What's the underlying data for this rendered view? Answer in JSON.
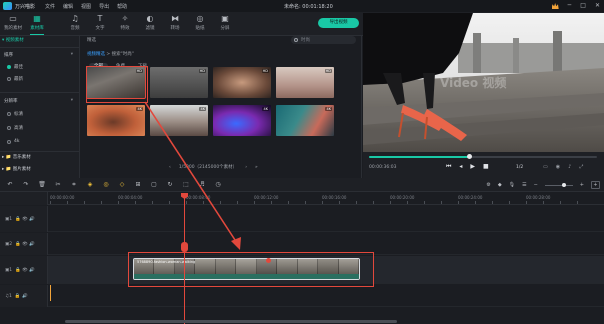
{
  "app": {
    "name": "万兴喵影",
    "menus": [
      "文件",
      "编辑",
      "视图",
      "导出",
      "帮助"
    ],
    "document_title": "未命名: 00:01:18:20",
    "window_controls": [
      "─",
      "□",
      "✕"
    ]
  },
  "toolbar": {
    "tools": [
      {
        "label": "我的素材",
        "icon": "folder-icon"
      },
      {
        "label": "素材库",
        "icon": "media-library-icon"
      },
      {
        "label": "音频",
        "icon": "music-note-icon"
      },
      {
        "label": "文字",
        "icon": "text-icon"
      },
      {
        "label": "特效",
        "icon": "effects-icon"
      },
      {
        "label": "滤镜",
        "icon": "filter-icon"
      },
      {
        "label": "转场",
        "icon": "transition-icon"
      },
      {
        "label": "贴纸",
        "icon": "sticker-icon"
      },
      {
        "label": "分屏",
        "icon": "split-screen-icon"
      }
    ],
    "active_tool": "素材库",
    "export_label": "导出视频"
  },
  "sidebar": {
    "header": "▾ 视频素材",
    "sections": [
      {
        "title": "排序",
        "items": [
          {
            "label": "最佳",
            "selected": true
          },
          {
            "label": "最新",
            "selected": false
          }
        ]
      },
      {
        "title": "分辨率",
        "items": [
          {
            "label": "标清",
            "selected": false
          },
          {
            "label": "高清",
            "selected": false
          },
          {
            "label": "4k",
            "selected": false
          }
        ]
      }
    ],
    "folders": [
      "▸ 📁 音乐素材",
      "▸ 📁 图片素材"
    ]
  },
  "library": {
    "heading": "精选",
    "search_placeholder": "时尚",
    "breadcrumb_link": "视频精选",
    "breadcrumb_rest": " > 搜索\"时尚\"",
    "subtabs": [
      "全部",
      "免费",
      "下载"
    ],
    "active_subtab": "全部",
    "thumb_badges": [
      "HD",
      "HD",
      "HD",
      "HD",
      "4K",
      "4K",
      "4K",
      "4K"
    ],
    "pager_text": "1/5000（2145000个素材）",
    "prev": "‹",
    "next": "›",
    "last": "»"
  },
  "preview": {
    "timecode": "00:00:36:03",
    "ratio": "1/2",
    "progress": 0.44,
    "watermark": "Video 视频"
  },
  "timeline": {
    "ruler_labels": [
      "00:00:00:00",
      "00:00:04:00",
      "00:00:08:00",
      "00:00:12:00",
      "00:00:16:00",
      "00:00:20:00",
      "00:00:24:00",
      "00:00:28:00"
    ],
    "clip_name": "5768890-fashion-woman-walking",
    "tracks": [
      {
        "num": "▣1",
        "icons": "🔒 👁 🔊"
      },
      {
        "num": "▣2",
        "icons": "🔒 👁 🔊"
      },
      {
        "num": "▣1",
        "icons": "🔒 👁 🔊"
      },
      {
        "num": "♫1",
        "icons": "🔒 🔊"
      }
    ]
  },
  "colors": {
    "accent": "#19c8a6",
    "annotation": "#e2483c",
    "bg": "#1b1d22"
  }
}
